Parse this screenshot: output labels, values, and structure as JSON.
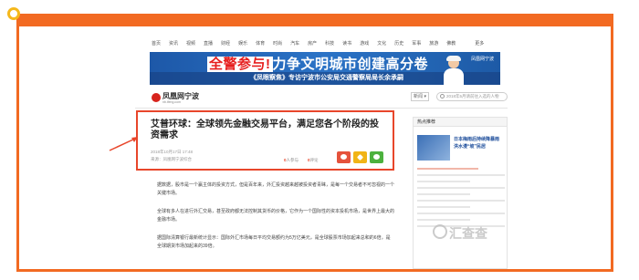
{
  "nav": {
    "items": [
      "首页",
      "资讯",
      "视频",
      "直播",
      "财经",
      "娱乐",
      "体育",
      "时尚",
      "汽车",
      "房产",
      "科技",
      "读书",
      "游戏",
      "文化",
      "历史",
      "军事",
      "旅游",
      "佛教"
    ],
    "more": "更多"
  },
  "banner": {
    "title_highlight": "全警参与!",
    "title_rest": "力争文明城市创建高分卷",
    "subtitle": "《凤眼察焦》专访宁波市公安局交通警察局局长余承嗣",
    "logo": "凤凰网宁波"
  },
  "site": {
    "logo_text": "凤凰网宁波",
    "logo_url": "nb.ifeng.com"
  },
  "search": {
    "select_value": "新闻",
    "placeholder": "2018年5月请前往入选的人物"
  },
  "article": {
    "title": "艾普环球：全球领先金融交易平台，满足您各个阶段的投资需求",
    "datetime": "2018年10月17日 17:48",
    "source": "来源：凤凰网宁波综合",
    "participants": "0",
    "participants_label": "人参与",
    "comments": "0",
    "comments_label": "评论",
    "paragraphs": [
      "据数据，股市是一个赢主体的投资方式，但是百年来，外汇投资越来越被投资者青睐，是每一个交易者不可忽视的一个关键市场。",
      "全球有多人在进行外汇交易，甚至政府都无法控制其货币的价格，它作为一个国际性的资本投机市场，是世界上最大的金融市场。",
      "据国际清算银行最新统计显示：国际外汇市场每日平均交易额约为5万亿美元，是全球股票市场加起来总和的6倍，是全球期货市场加起来的39倍。"
    ]
  },
  "sidebar": {
    "header": "热点推荐",
    "thumb_title": "日本梅雨后持续降暴雨 洪水漫“坡”民居"
  },
  "watermark": "汇查查",
  "colors": {
    "frame": "#f26a22",
    "highlight": "#e8462b",
    "weibo": "#e5523c",
    "qzone": "#f1b417",
    "wechat": "#4cb13e"
  }
}
